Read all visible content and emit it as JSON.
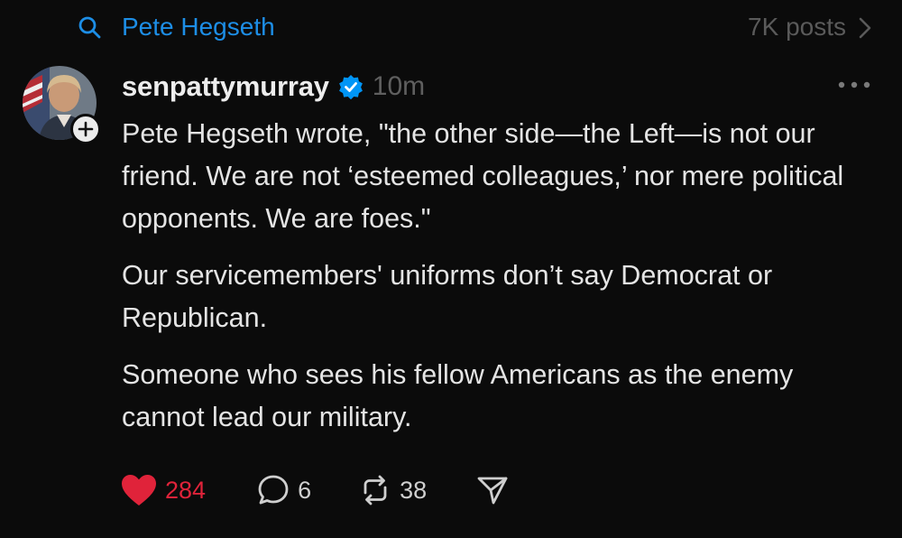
{
  "topic": {
    "label": "Pete Hegseth",
    "post_count": "7K posts",
    "color": "#1d8ee6"
  },
  "post": {
    "author": {
      "username": "senpattymurray",
      "verified": true,
      "avatar": "person-portrait-with-flag"
    },
    "timestamp": "10m",
    "paragraphs": [
      "Pete Hegseth wrote, \"the other side—the Left—is not our friend. We are not ‘esteemed colleagues,’ nor mere political opponents. We are foes.\"",
      "Our servicemembers' uniforms don’t say Democrat or Republican.",
      "Someone who sees his fellow Americans as the enemy cannot lead our military."
    ],
    "actions": {
      "likes": "284",
      "replies": "6",
      "reposts": "38",
      "liked": true
    }
  },
  "colors": {
    "background": "#0b0b0b",
    "like_red": "#e0233a",
    "verified_blue": "#0095f6",
    "muted": "#5a5a5a"
  },
  "icons": [
    "search-icon",
    "chevron-right-icon",
    "verified-icon",
    "more-icon",
    "plus-icon",
    "heart-icon",
    "comment-icon",
    "repost-icon",
    "share-icon"
  ]
}
